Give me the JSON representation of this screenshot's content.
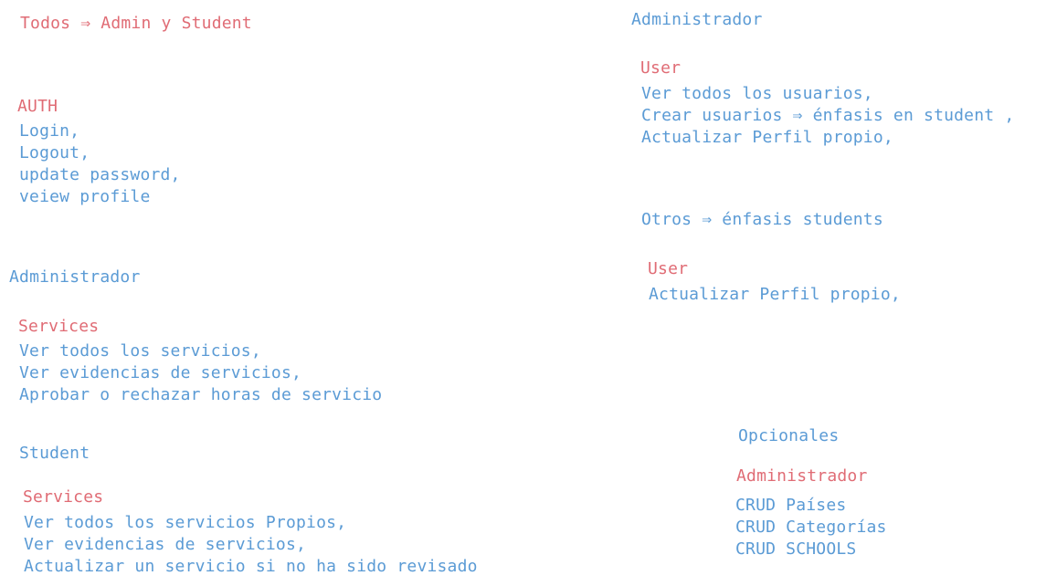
{
  "title": "Todos ⇒ Admin y Student",
  "auth": {
    "heading": "AUTH",
    "items": [
      "Login,",
      "Logout,",
      "update password,",
      "veiew profile"
    ]
  },
  "left_admin": {
    "role": "Administrador",
    "section": "Services",
    "items": [
      "Ver todos los servicios,",
      "Ver evidencias de servicios,",
      "Aprobar o rechazar horas de servicio"
    ]
  },
  "left_student": {
    "role": "Student",
    "section": "Services",
    "items": [
      "Ver todos los servicios Propios,",
      "Ver evidencias de servicios,",
      "Actualizar un servicio si no ha sido revisado"
    ]
  },
  "right_admin": {
    "role": "Administrador",
    "section": "User",
    "items": [
      "Ver todos los usuarios,",
      "Crear usuarios ⇒ énfasis en student ,",
      "Actualizar Perfil propio,"
    ]
  },
  "right_others": {
    "role": "Otros ⇒ énfasis students",
    "section": "User",
    "items": [
      "Actualizar Perfil propio,"
    ]
  },
  "optional": {
    "heading": "Opcionales",
    "section": "Administrador",
    "items": [
      "CRUD Países",
      "CRUD Categorías",
      "CRUD SCHOOLS"
    ]
  }
}
